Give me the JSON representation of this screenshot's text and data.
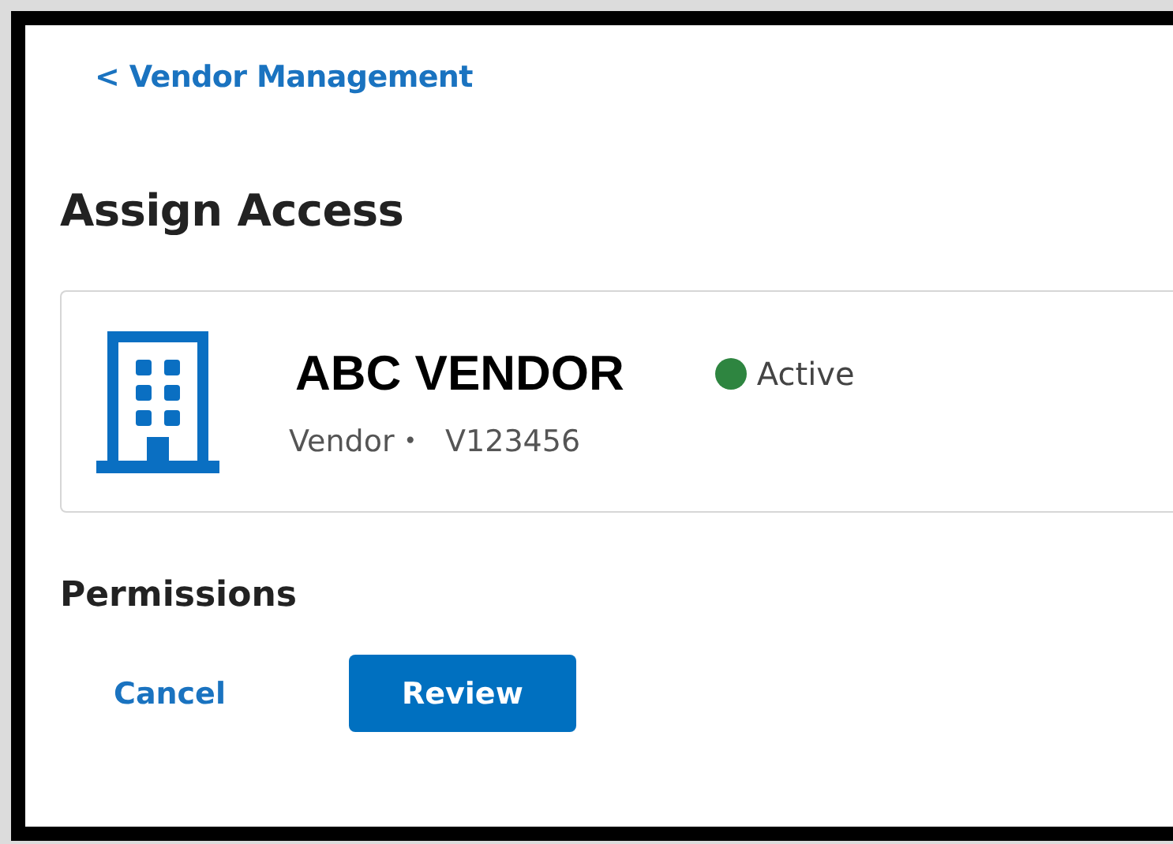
{
  "back_link": "< Vendor Management",
  "title": "Assign Access",
  "vendor": {
    "name": "ABC VENDOR",
    "status": {
      "label": "Active",
      "color": "#2e8540"
    },
    "type": "Vendor",
    "separator": "•",
    "id": "V123456"
  },
  "section_heading": "Permissions",
  "buttons": [
    {
      "label": "Cancel",
      "kind": "link"
    },
    {
      "label": "Review",
      "kind": "primary"
    }
  ]
}
